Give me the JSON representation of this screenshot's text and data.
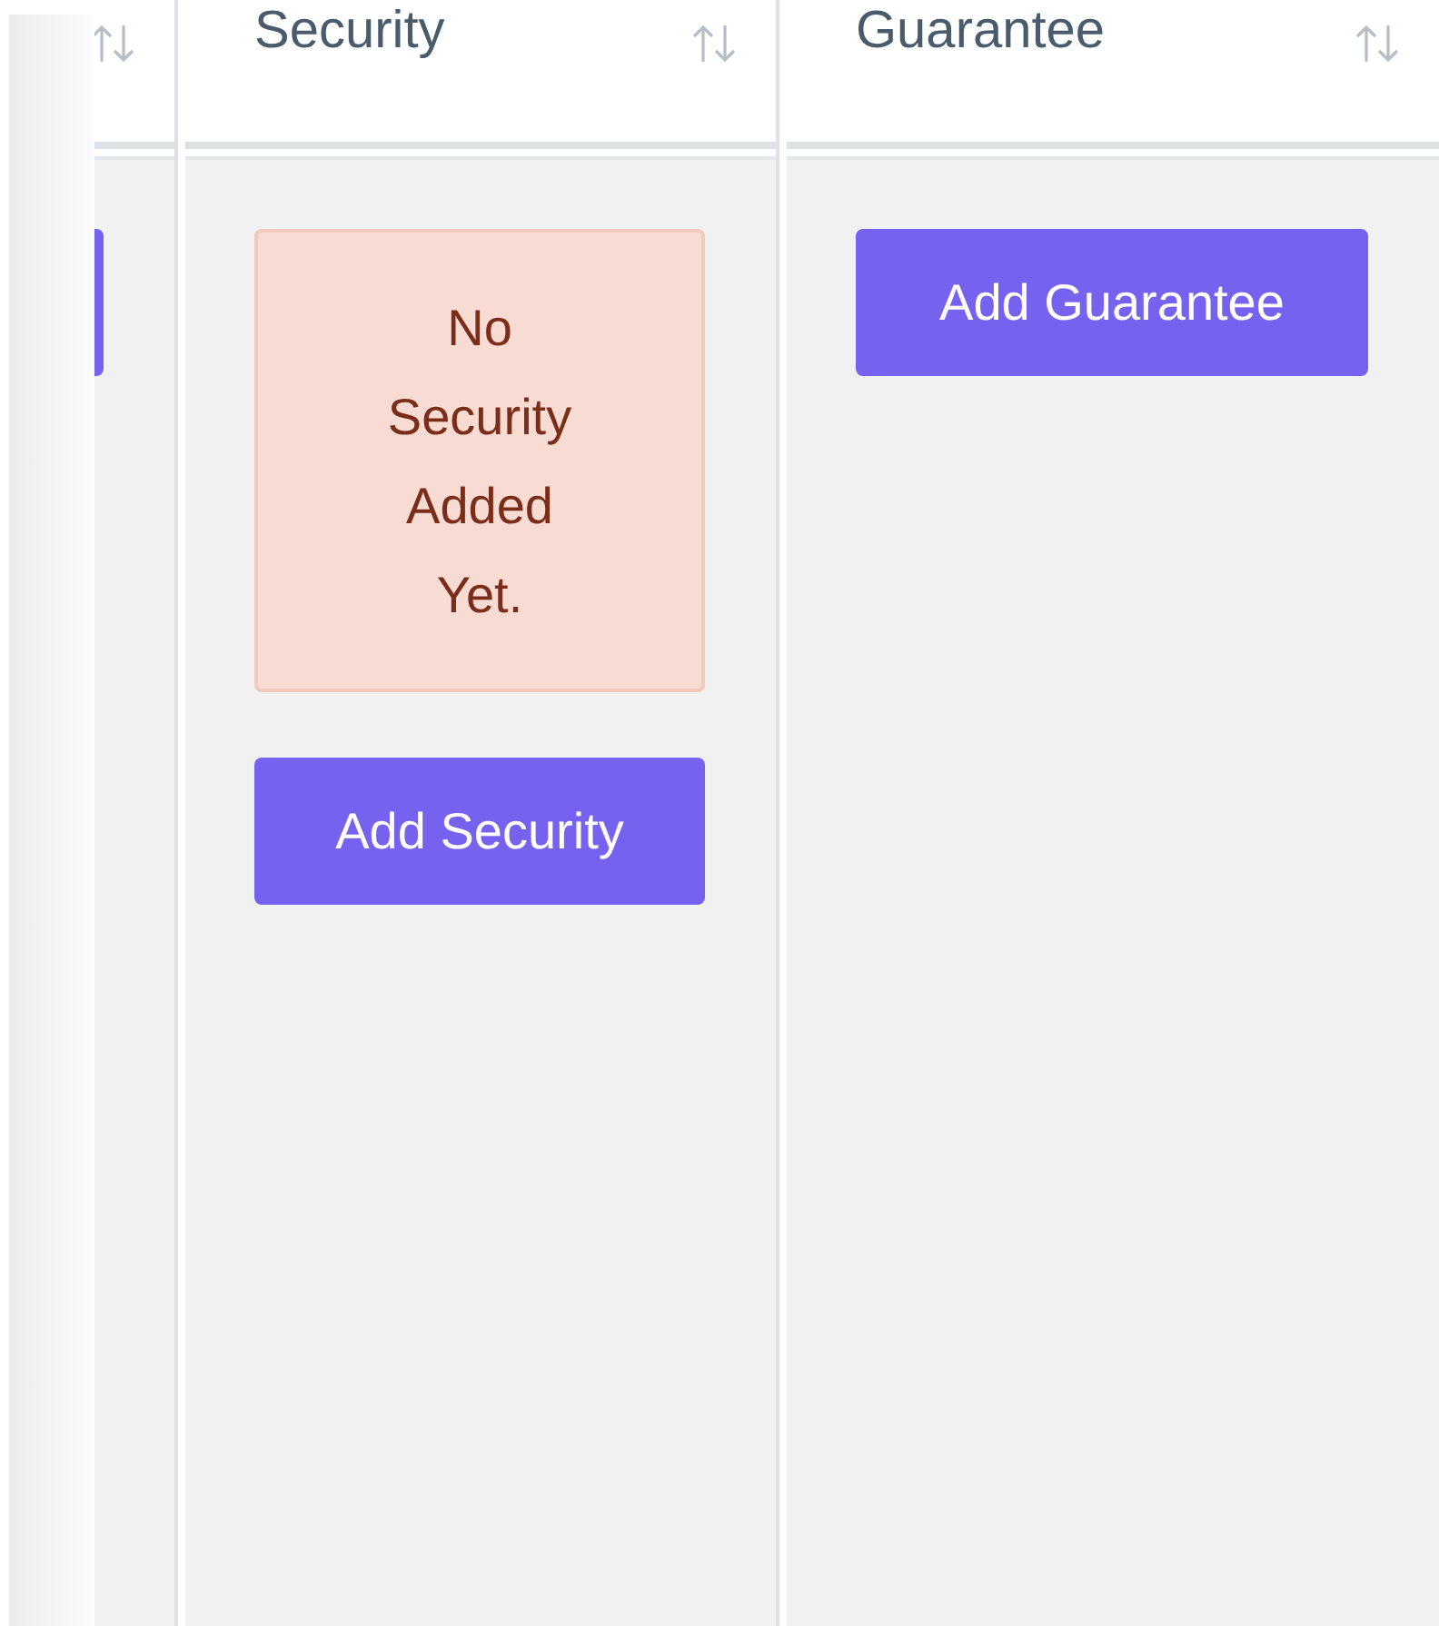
{
  "table": {
    "columns": [
      {
        "sortable": true,
        "cell": [
          {
            "kind": "button"
          }
        ]
      },
      {
        "heading": "Security",
        "sortable": true,
        "cell": [
          {
            "kind": "alert",
            "text": "No Security Added Yet."
          },
          {
            "kind": "button",
            "label": "Add Security"
          }
        ]
      },
      {
        "heading": "Guarantee",
        "sortable": true,
        "cell": [
          {
            "kind": "button",
            "label": "Add Guarantee"
          }
        ]
      }
    ]
  }
}
